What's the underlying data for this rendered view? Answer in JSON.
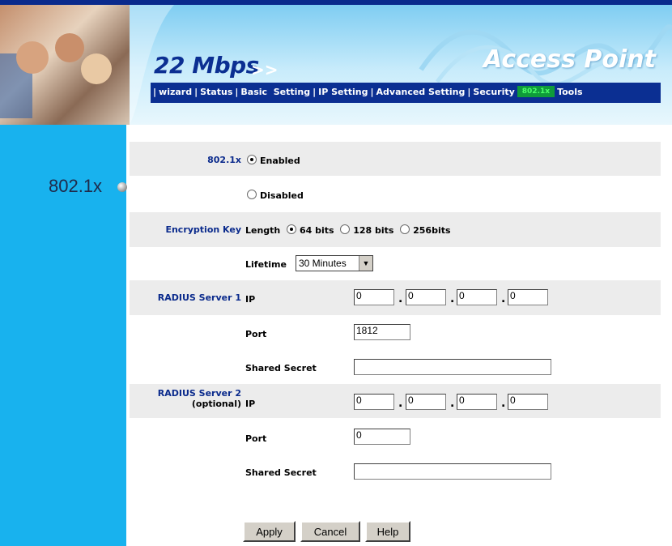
{
  "header": {
    "brand": "22 Mbps",
    "brand_arrow": ">>",
    "product": "Access Point"
  },
  "menu": {
    "items": [
      {
        "label": "wizard"
      },
      {
        "label": "Status"
      },
      {
        "label": "Basic  Setting"
      },
      {
        "label": "IP Setting"
      },
      {
        "label": "Advanced Setting"
      },
      {
        "label": "Security"
      },
      {
        "label": "802.1x",
        "active": true
      },
      {
        "label": "Tools"
      }
    ],
    "separator": "|"
  },
  "sidebar": {
    "page_label": "802.1x"
  },
  "form": {
    "dot1x": {
      "label": "802.1x",
      "enabled_label": "Enabled",
      "disabled_label": "Disabled",
      "selected": "Enabled"
    },
    "encryption_key": {
      "label": "Encryption Key",
      "length_label": "Length",
      "options": [
        "64 bits",
        "128 bits",
        "256bits"
      ],
      "selected": "64 bits",
      "lifetime_label": "Lifetime",
      "lifetime_value": "30 Minutes"
    },
    "radius1": {
      "label": "RADIUS Server 1",
      "ip_label": "IP",
      "ip": [
        "0",
        "0",
        "0",
        "0"
      ],
      "port_label": "Port",
      "port": "1812",
      "secret_label": "Shared Secret",
      "secret": ""
    },
    "radius2": {
      "label_line1": "RADIUS Server 2",
      "label_line2": "(optional)",
      "ip_label": "IP",
      "ip": [
        "0",
        "0",
        "0",
        "0"
      ],
      "port_label": "Port",
      "port": "0",
      "secret_label": "Shared Secret",
      "secret": ""
    }
  },
  "buttons": {
    "apply": "Apply",
    "cancel": "Cancel",
    "help": "Help"
  },
  "colors": {
    "navy": "#0b2f92",
    "sidebar": "#18b2ee",
    "active_tab": "#0f9b3a",
    "band": "#ececec"
  },
  "icons": {
    "page_bullet": "sphere-bullet-icon"
  }
}
